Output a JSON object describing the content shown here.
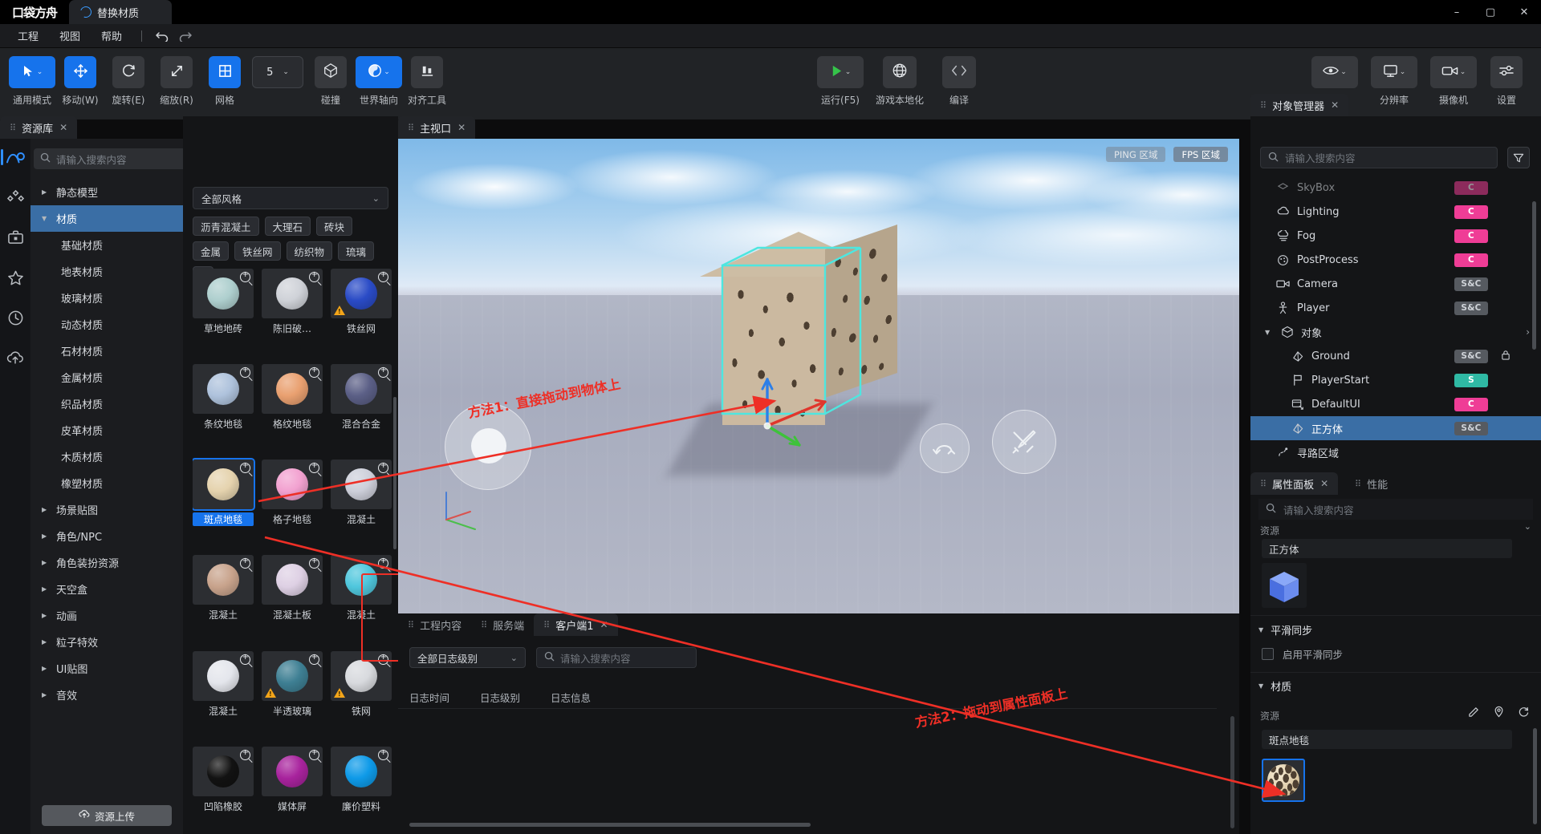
{
  "titlebar": {
    "logo": "口袋方舟",
    "tab_label": "替换材质",
    "window_buttons": [
      "–",
      "▢",
      "✕"
    ]
  },
  "menubar": {
    "items": [
      "工程",
      "视图",
      "帮助"
    ],
    "undo_icon": "undo-icon",
    "redo_icon": "redo-icon"
  },
  "toolbar": {
    "left": [
      {
        "label": "通用模式",
        "icon": "cursor-icon",
        "active": true,
        "caret": true
      },
      {
        "label": "移动(W)",
        "icon": "move-icon",
        "active": true,
        "caret": false
      },
      {
        "label": "旋转(E)",
        "icon": "rotate-icon",
        "active": false,
        "caret": false
      },
      {
        "label": "缩放(R)",
        "icon": "scale-icon",
        "active": false,
        "caret": false
      },
      {
        "label": "网格",
        "icon": "grid-icon",
        "active": true,
        "caret": false
      }
    ],
    "grid_value": "5",
    "left2": [
      {
        "label": "碰撞",
        "icon": "collision-icon",
        "active": false,
        "caret": false
      },
      {
        "label": "世界轴向",
        "icon": "world-axis-icon",
        "active": true,
        "caret": true
      },
      {
        "label": "对齐工具",
        "icon": "align-icon",
        "active": false,
        "caret": false
      }
    ],
    "center": [
      {
        "label": "运行(F5)",
        "icon": "play-icon",
        "caret": true
      },
      {
        "label": "游戏本地化",
        "icon": "globe-icon",
        "caret": false
      },
      {
        "label": "编译",
        "icon": "code-icon",
        "caret": false
      }
    ],
    "right": [
      {
        "label": "显示",
        "icon": "eye-icon",
        "caret": true
      },
      {
        "label": "分辨率",
        "icon": "monitor-icon",
        "caret": true
      },
      {
        "label": "摄像机",
        "icon": "camera-icon",
        "caret": true
      },
      {
        "label": "设置",
        "icon": "sliders-icon",
        "caret": false
      }
    ]
  },
  "rail": [
    {
      "name": "logo-icon",
      "selected": true
    },
    {
      "name": "nodes-icon",
      "selected": false
    },
    {
      "name": "toolbox-icon",
      "selected": false
    },
    {
      "name": "star-icon",
      "selected": false
    },
    {
      "name": "clock-icon",
      "selected": false
    },
    {
      "name": "cloud-upload-icon",
      "selected": false
    }
  ],
  "assets": {
    "tab_title": "资源库",
    "search_placeholder": "请输入搜索内容",
    "tree": [
      {
        "label": "静态模型",
        "level": 0,
        "expandable": true,
        "expanded": false,
        "selected": false
      },
      {
        "label": "材质",
        "level": 0,
        "expandable": true,
        "expanded": true,
        "selected": true
      },
      {
        "label": "基础材质",
        "level": 1,
        "expandable": false,
        "expanded": false,
        "selected": false
      },
      {
        "label": "地表材质",
        "level": 1,
        "expandable": false,
        "expanded": false,
        "selected": false
      },
      {
        "label": "玻璃材质",
        "level": 1,
        "expandable": false,
        "expanded": false,
        "selected": false
      },
      {
        "label": "动态材质",
        "level": 1,
        "expandable": false,
        "expanded": false,
        "selected": false
      },
      {
        "label": "石材材质",
        "level": 1,
        "expandable": false,
        "expanded": false,
        "selected": false
      },
      {
        "label": "金属材质",
        "level": 1,
        "expandable": false,
        "expanded": false,
        "selected": false
      },
      {
        "label": "织品材质",
        "level": 1,
        "expandable": false,
        "expanded": false,
        "selected": false
      },
      {
        "label": "皮革材质",
        "level": 1,
        "expandable": false,
        "expanded": false,
        "selected": false
      },
      {
        "label": "木质材质",
        "level": 1,
        "expandable": false,
        "expanded": false,
        "selected": false
      },
      {
        "label": "橡塑材质",
        "level": 1,
        "expandable": false,
        "expanded": false,
        "selected": false
      },
      {
        "label": "场景贴图",
        "level": 0,
        "expandable": true,
        "expanded": false,
        "selected": false
      },
      {
        "label": "角色/NPC",
        "level": 0,
        "expandable": true,
        "expanded": false,
        "selected": false
      },
      {
        "label": "角色装扮资源",
        "level": 0,
        "expandable": true,
        "expanded": false,
        "selected": false
      },
      {
        "label": "天空盒",
        "level": 0,
        "expandable": true,
        "expanded": false,
        "selected": false
      },
      {
        "label": "动画",
        "level": 0,
        "expandable": true,
        "expanded": false,
        "selected": false
      },
      {
        "label": "粒子特效",
        "level": 0,
        "expandable": true,
        "expanded": false,
        "selected": false
      },
      {
        "label": "UI贴图",
        "level": 0,
        "expandable": true,
        "expanded": false,
        "selected": false
      },
      {
        "label": "音效",
        "level": 0,
        "expandable": true,
        "expanded": false,
        "selected": false
      }
    ],
    "upload_button": "资源上传"
  },
  "materials": {
    "style_filter": "全部风格",
    "tags": [
      "沥青混凝土",
      "大理石",
      "砖块",
      "金属",
      "铁丝网",
      "纺织物",
      "琉璃"
    ],
    "more_tag_icon": "chevron-down-icon",
    "items": [
      {
        "name": "草地地砖",
        "color": "#aecfce",
        "warn": false,
        "selected": false
      },
      {
        "name": "陈旧破…",
        "color": "#cfd2d8",
        "warn": false,
        "selected": false
      },
      {
        "name": "铁丝网",
        "color": "#2a4bc6",
        "warn": true,
        "selected": false
      },
      {
        "name": "条纹地毯",
        "color": "#aec2dc",
        "warn": false,
        "selected": false
      },
      {
        "name": "格纹地毯",
        "color": "#e9a070",
        "warn": false,
        "selected": false
      },
      {
        "name": "混合合金",
        "color": "#5b5f86",
        "warn": false,
        "selected": false
      },
      {
        "name": "斑点地毯",
        "color": "#e5d3ae",
        "warn": false,
        "selected": true
      },
      {
        "name": "格子地毯",
        "color": "#f2a1d0",
        "warn": false,
        "selected": false
      },
      {
        "name": "混凝土",
        "color": "#cdcfda",
        "warn": false,
        "selected": false
      },
      {
        "name": "混凝土",
        "color": "#c8a38c",
        "warn": false,
        "selected": false
      },
      {
        "name": "混凝土板",
        "color": "#ded0e4",
        "warn": false,
        "selected": false
      },
      {
        "name": "混凝土",
        "color": "#4fc7dd",
        "warn": false,
        "selected": false
      },
      {
        "name": "混凝土",
        "color": "#e4e6ec",
        "warn": false,
        "selected": false
      },
      {
        "name": "半透玻璃",
        "color": "#3e7f93",
        "warn": true,
        "selected": false
      },
      {
        "name": "铁网",
        "color": "#d8dade",
        "warn": true,
        "selected": false
      },
      {
        "name": "凹陷橡胶",
        "color": "#121212",
        "warn": false,
        "selected": false
      },
      {
        "name": "媒体屏",
        "color": "#a8239d",
        "warn": false,
        "selected": false
      },
      {
        "name": "廉价塑料",
        "color": "#0e9ae8",
        "warn": false,
        "selected": false
      }
    ]
  },
  "viewport": {
    "tab_title": "主视口",
    "badges": [
      {
        "label": "PING 区域",
        "dim": true
      },
      {
        "label": "FPS 区域",
        "dim": false
      }
    ]
  },
  "annotations": [
    {
      "text": "方法1：直接拖动到物体上"
    },
    {
      "text": "方法2：拖动到属性面板上"
    }
  ],
  "console": {
    "tabs": [
      {
        "label": "工程内容",
        "active": false,
        "closable": false
      },
      {
        "label": "服务端",
        "active": false,
        "closable": false
      },
      {
        "label": "客户端1",
        "active": true,
        "closable": true
      }
    ],
    "level_filter": "全部日志级别",
    "search_placeholder": "请输入搜索内容",
    "columns": [
      "日志时间",
      "日志级别",
      "日志信息"
    ],
    "rows": []
  },
  "object_manager": {
    "tab_title": "对象管理器",
    "search_placeholder": "请输入搜索内容",
    "filter_icon": "filter-icon",
    "items": [
      {
        "label": "SkyBox",
        "icon": "skybox-icon",
        "chip": "C",
        "chip_kind": "c",
        "level": 1,
        "selected": false,
        "locked": false,
        "partial": true
      },
      {
        "label": "Lighting",
        "icon": "lighting-icon",
        "chip": "C",
        "chip_kind": "c",
        "level": 1,
        "selected": false,
        "locked": false
      },
      {
        "label": "Fog",
        "icon": "fog-icon",
        "chip": "C",
        "chip_kind": "c",
        "level": 1,
        "selected": false,
        "locked": false
      },
      {
        "label": "PostProcess",
        "icon": "postprocess-icon",
        "chip": "C",
        "chip_kind": "c",
        "level": 1,
        "selected": false,
        "locked": false
      },
      {
        "label": "Camera",
        "icon": "camera-icon",
        "chip": "S&C",
        "chip_kind": "sc",
        "level": 1,
        "selected": false,
        "locked": false
      },
      {
        "label": "Player",
        "icon": "player-icon",
        "chip": "S&C",
        "chip_kind": "sc",
        "level": 1,
        "selected": false,
        "locked": false
      },
      {
        "label": "对象",
        "icon": "cube-icon",
        "chip": "",
        "chip_kind": "",
        "level": 0,
        "selected": false,
        "locked": false,
        "group": true
      },
      {
        "label": "Ground",
        "icon": "mesh-icon",
        "chip": "S&C",
        "chip_kind": "sc",
        "level": 2,
        "selected": false,
        "locked": true
      },
      {
        "label": "PlayerStart",
        "icon": "flag-icon",
        "chip": "S",
        "chip_kind": "s",
        "level": 2,
        "selected": false,
        "locked": false
      },
      {
        "label": "DefaultUI",
        "icon": "ui-icon",
        "chip": "C",
        "chip_kind": "c",
        "level": 2,
        "selected": false,
        "locked": false
      },
      {
        "label": "正方体",
        "icon": "mesh-icon",
        "chip": "S&C",
        "chip_kind": "sc",
        "level": 2,
        "selected": true,
        "locked": false
      },
      {
        "label": "寻路区域",
        "icon": "nav-icon",
        "chip": "",
        "chip_kind": "",
        "level": 1,
        "selected": false,
        "locked": false
      }
    ]
  },
  "properties": {
    "tabs": [
      {
        "label": "属性面板",
        "active": true,
        "closable": true
      },
      {
        "label": "性能",
        "active": false,
        "closable": false
      }
    ],
    "search_placeholder": "请输入搜索内容",
    "resource_label": "资源",
    "object_name": "正方体",
    "object_thumb_icon": "blue-cube-icon",
    "sections": [
      {
        "title": "平滑同步",
        "expanded": true
      },
      {
        "title": "材质",
        "expanded": true
      }
    ],
    "smooth_sync_checkbox": "启用平滑同步",
    "smooth_sync_checked": false,
    "material_resource_label": "资源",
    "material_name": "斑点地毯",
    "material_actions": [
      "edit-icon",
      "locate-icon",
      "reset-icon"
    ]
  },
  "colors": {
    "accent": "#1673ec",
    "selection": "#3a6ea5",
    "annotation_red": "#ee2f26",
    "chip_c": "#ef3d96",
    "chip_s": "#2fb9a4",
    "chip_sc": "#565a60",
    "play_green": "#35c44a",
    "panel_bg": "#141517",
    "toolbar_bg": "#212326"
  }
}
